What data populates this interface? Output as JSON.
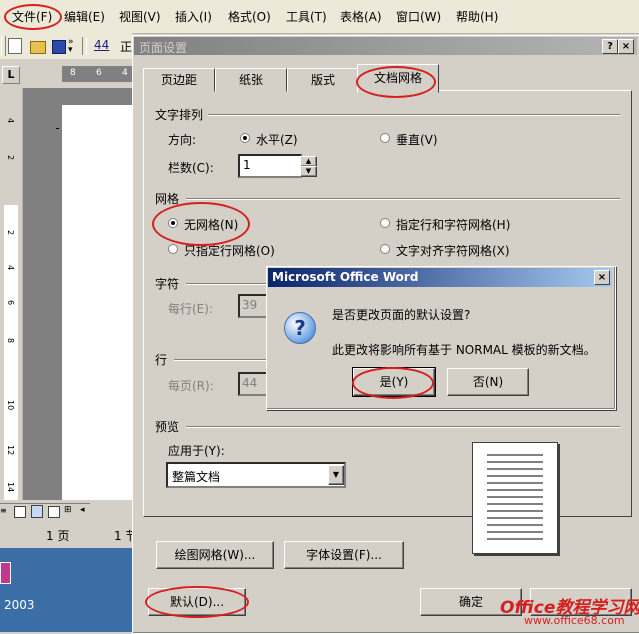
{
  "menubar": {
    "items": [
      "文件(F)",
      "编辑(E)",
      "视图(V)",
      "插入(I)",
      "格式(O)",
      "工具(T)",
      "表格(A)",
      "窗口(W)",
      "帮助(H)"
    ]
  },
  "toolbar": {
    "style_fragment": "44"
  },
  "ruler": {
    "top_ticks": [
      "8",
      "6",
      "4"
    ],
    "left_ticks": [
      "4",
      "2",
      "2",
      "4",
      "6",
      "8",
      "10",
      "12",
      "14"
    ]
  },
  "statusbar": {
    "page": "1 页",
    "section": "1 节"
  },
  "taskbar": {
    "year": "2003"
  },
  "dialog": {
    "title": "页面设置",
    "help_btn": "?",
    "close_btn": "×",
    "tabs": [
      "页边距",
      "纸张",
      "版式",
      "文档网格"
    ],
    "text_layout": {
      "title": "文字排列",
      "direction_label": "方向:",
      "horizontal": "水平(Z)",
      "vertical": "垂直(V)",
      "columns_label": "栏数(C):",
      "columns_value": "1"
    },
    "grid": {
      "title": "网格",
      "no_grid": "无网格(N)",
      "line_char_grid": "指定行和字符网格(H)",
      "line_only": "只指定行网格(O)",
      "text_align_char": "文字对齐字符网格(X)"
    },
    "chars": {
      "title": "字符",
      "per_line_label": "每行(E):",
      "per_line_value": "39"
    },
    "lines": {
      "title": "行",
      "per_page_label": "每页(R):",
      "per_page_value": "44"
    },
    "preview": {
      "title": "预览",
      "apply_label": "应用于(Y):",
      "apply_value": "整篇文档"
    },
    "draw_grid_btn": "绘图网格(W)...",
    "font_settings_btn": "字体设置(F)...",
    "default_btn": "默认(D)...",
    "ok_btn": "确定"
  },
  "msgbox": {
    "title": "Microsoft Office Word",
    "close": "×",
    "question": "是否更改页面的默认设置?",
    "detail": "此更改将影响所有基于 NORMAL 模板的新文档。",
    "yes": "是(Y)",
    "no": "否(N)"
  },
  "watermark": {
    "brand": "Office教程学习网",
    "url": "www.office68.com"
  },
  "colors": {
    "accent_red": "#d62020",
    "title_active": "#0a246a",
    "title_inactive": "#808080"
  }
}
